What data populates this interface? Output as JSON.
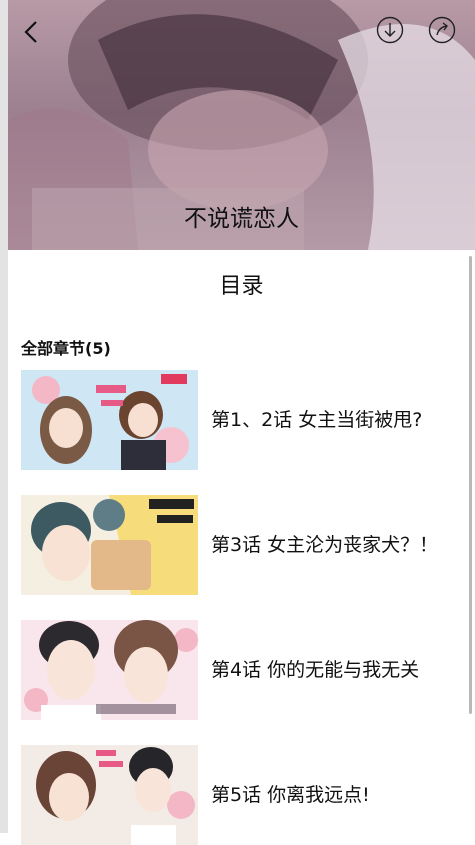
{
  "cover": {
    "title": "不说谎恋人",
    "back_icon": "chevron-left-icon",
    "download_icon": "download-icon",
    "share_icon": "share-icon"
  },
  "toc": {
    "title": "目录",
    "section_label": "全部章节(5)"
  },
  "chapters": [
    {
      "title": "第1、2话 女主当街被甩?"
    },
    {
      "title": "第3话 女主沦为丧家犬？！"
    },
    {
      "title": "第4话 你的无能与我无关"
    },
    {
      "title": "第5话 你离我远点!"
    }
  ]
}
